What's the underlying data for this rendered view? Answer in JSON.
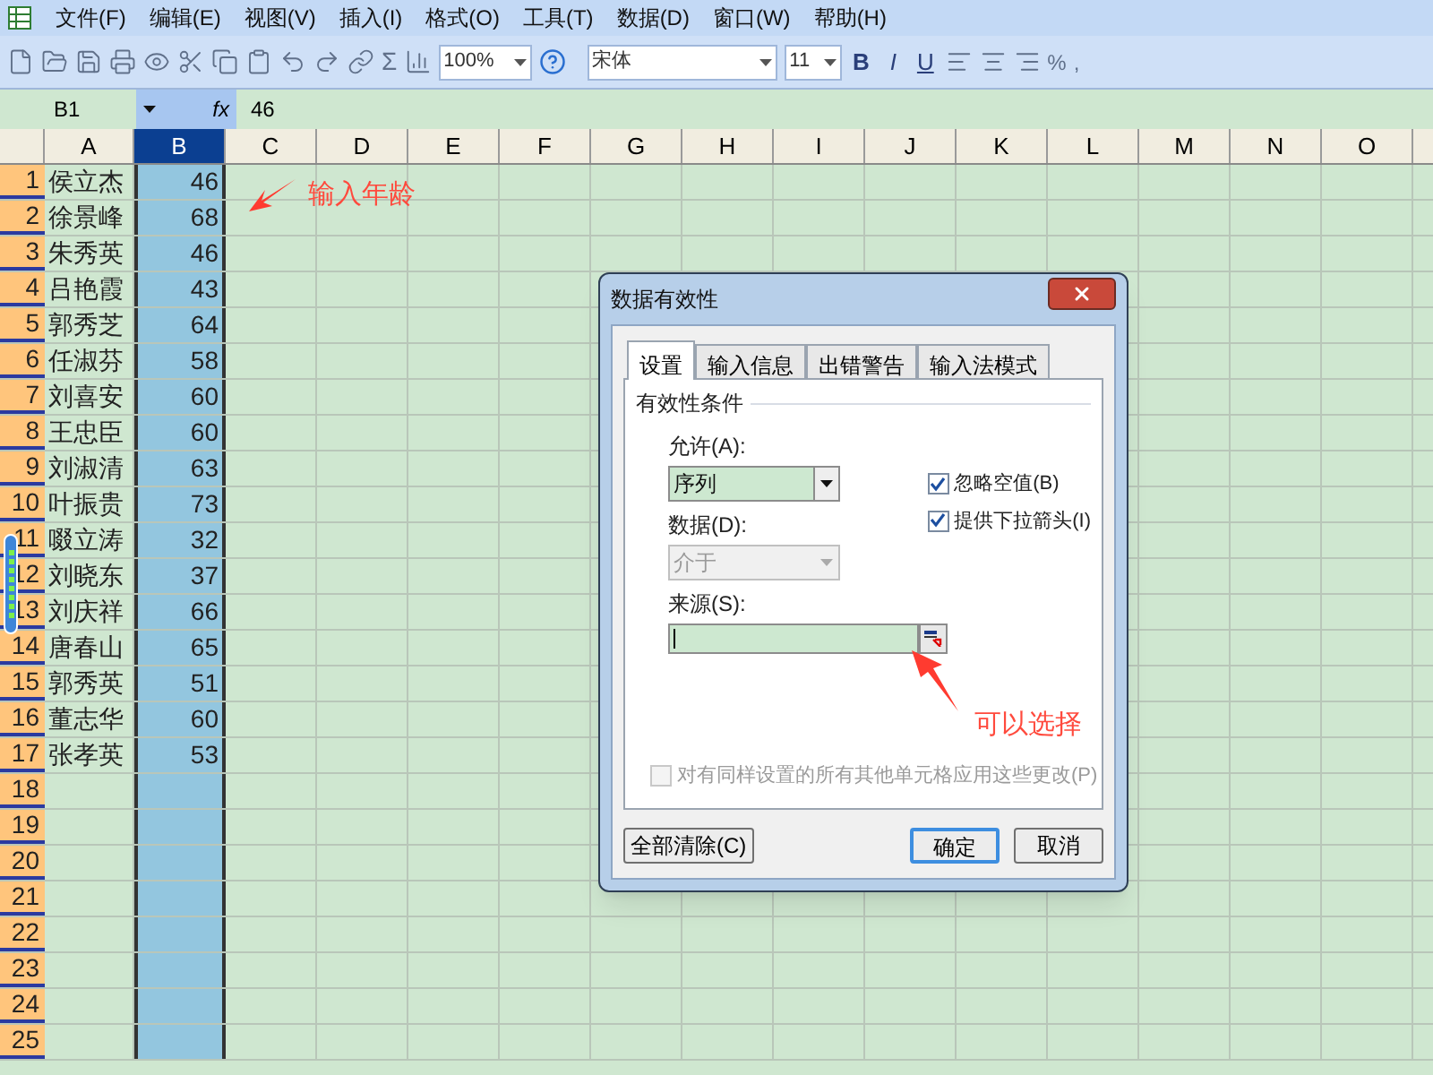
{
  "menu": [
    {
      "label": "文件(F)"
    },
    {
      "label": "编辑(E)"
    },
    {
      "label": "视图(V)"
    },
    {
      "label": "插入(I)"
    },
    {
      "label": "格式(O)"
    },
    {
      "label": "工具(T)"
    },
    {
      "label": "数据(D)"
    },
    {
      "label": "窗口(W)"
    },
    {
      "label": "帮助(H)"
    }
  ],
  "toolbar": {
    "sigma": "Σ",
    "zoom": "100%",
    "font": "宋体",
    "size": "11",
    "format_buttons": [
      "B",
      "I",
      "U"
    ],
    "percent": "%",
    "comma": ","
  },
  "formula_bar": {
    "name_box": "B1",
    "fx": "fx",
    "value": "46"
  },
  "columns": [
    {
      "label": "A",
      "selected": false
    },
    {
      "label": "B",
      "selected": true
    },
    {
      "label": "C",
      "selected": false
    },
    {
      "label": "D",
      "selected": false
    },
    {
      "label": "E",
      "selected": false
    },
    {
      "label": "F",
      "selected": false
    },
    {
      "label": "G",
      "selected": false
    },
    {
      "label": "H",
      "selected": false
    },
    {
      "label": "I",
      "selected": false
    },
    {
      "label": "J",
      "selected": false
    },
    {
      "label": "K",
      "selected": false
    },
    {
      "label": "L",
      "selected": false
    },
    {
      "label": "M",
      "selected": false
    },
    {
      "label": "N",
      "selected": false
    },
    {
      "label": "O",
      "selected": false
    }
  ],
  "rows": [
    {
      "number": "1",
      "name": "侯立杰",
      "age": "46"
    },
    {
      "number": "2",
      "name": "徐景峰",
      "age": "68"
    },
    {
      "number": "3",
      "name": "朱秀英",
      "age": "46"
    },
    {
      "number": "4",
      "name": "吕艳霞",
      "age": "43"
    },
    {
      "number": "5",
      "name": "郭秀芝",
      "age": "64"
    },
    {
      "number": "6",
      "name": "任淑芬",
      "age": "58"
    },
    {
      "number": "7",
      "name": "刘喜安",
      "age": "60"
    },
    {
      "number": "8",
      "name": "王忠臣",
      "age": "60"
    },
    {
      "number": "9",
      "name": "刘淑清",
      "age": "63"
    },
    {
      "number": "10",
      "name": "叶振贵",
      "age": "73"
    },
    {
      "number": "11",
      "name": "啜立涛",
      "age": "32"
    },
    {
      "number": "12",
      "name": "刘晓东",
      "age": "37"
    },
    {
      "number": "13",
      "name": "刘庆祥",
      "age": "66"
    },
    {
      "number": "14",
      "name": "唐春山",
      "age": "65"
    },
    {
      "number": "15",
      "name": "郭秀英",
      "age": "51"
    },
    {
      "number": "16",
      "name": "董志华",
      "age": "60"
    },
    {
      "number": "17",
      "name": "张孝英",
      "age": "53"
    },
    {
      "number": "18"
    },
    {
      "number": "19"
    },
    {
      "number": "20"
    },
    {
      "number": "21"
    },
    {
      "number": "22"
    },
    {
      "number": "23"
    },
    {
      "number": "24"
    },
    {
      "number": "25"
    }
  ],
  "annotations": [
    {
      "kind": "age",
      "text": "输入年龄"
    },
    {
      "kind": "select",
      "text": "可以选择"
    }
  ],
  "dialog": {
    "title": "数据有效性",
    "tabs": [
      {
        "label": "设置",
        "selected": true
      },
      {
        "label": "输入信息",
        "selected": false
      },
      {
        "label": "出错警告",
        "selected": false
      },
      {
        "label": "输入法模式",
        "selected": false
      }
    ],
    "section": "有效性条件",
    "allow_label": "允许(A):",
    "allow_value": "序列",
    "data_label": "数据(D):",
    "data_value": "介于",
    "data_disabled": true,
    "source_label": "来源(S):",
    "checkboxes": [
      {
        "label": "忽略空值(B)",
        "checked": true
      },
      {
        "label": "提供下拉箭头(I)",
        "checked": true
      }
    ],
    "apply_all": {
      "label": "对有同样设置的所有其他单元格应用这些更改(P)",
      "checked": false,
      "disabled": true
    },
    "buttons": [
      {
        "kind": "clear",
        "label": "全部清除(C)"
      },
      {
        "kind": "ok",
        "label": "确定"
      },
      {
        "kind": "cancel",
        "label": "取消"
      }
    ]
  }
}
